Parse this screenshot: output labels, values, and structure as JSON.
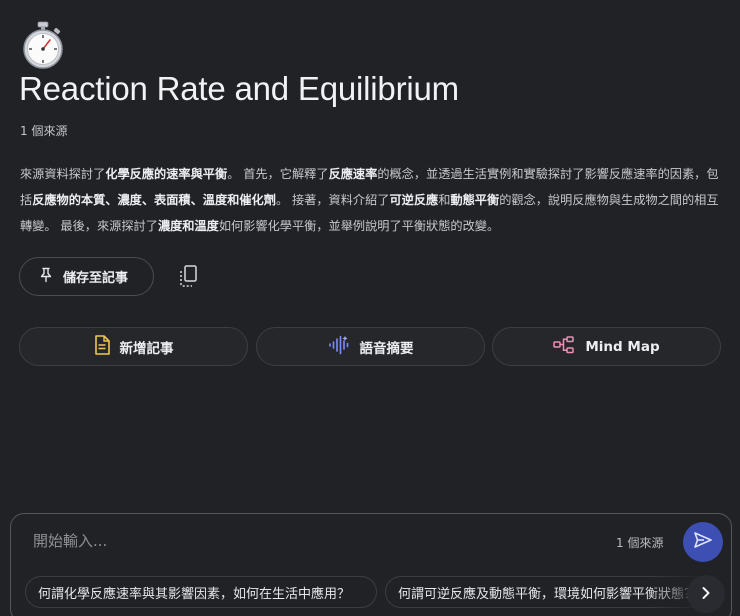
{
  "notebook": {
    "icon": "stopwatch-icon",
    "title": "Reaction Rate and Equilibrium",
    "source_count": "1 個來源"
  },
  "summary": {
    "p1": "來源資料探討了",
    "b1": "化學反應的速率與平衡",
    "p2": "。 首先，它解釋了",
    "b2": "反應速率",
    "p3": "的概念，並透過生活實例和實驗探討了影響反應速率的因素，包括",
    "b3": "反應物的本質、濃度、表面積、溫度和催化劑",
    "p4": "。 接著，資料介紹了",
    "b4": "可逆反應",
    "p5": "和",
    "b5": "動態平衡",
    "p6": "的觀念，說明反應物與生成物之間的相互轉變。 最後，來源探討了",
    "b6": "濃度和溫度",
    "p7": "如何影響化學平衡，並舉例說明了平衡狀態的改變。"
  },
  "actions": {
    "save_label": "儲存至記事",
    "add_note_label": "新增記事",
    "audio_overview_label": "語音摘要",
    "mind_map_label": "Mind Map"
  },
  "composer": {
    "placeholder": "開始輸入...",
    "source_count": "1 個來源"
  },
  "suggestions": [
    "何謂化學反應速率與其影響因素，如何在生活中應用？",
    "何謂可逆反應及動態平衡，環境如何影響平衡狀態？"
  ],
  "colors": {
    "background": "#212226",
    "send_button": "#3d4fb3",
    "note_icon": "#f2c84b",
    "audio_icon": "#7b8cff",
    "mindmap_icon": "#f08fb8"
  }
}
